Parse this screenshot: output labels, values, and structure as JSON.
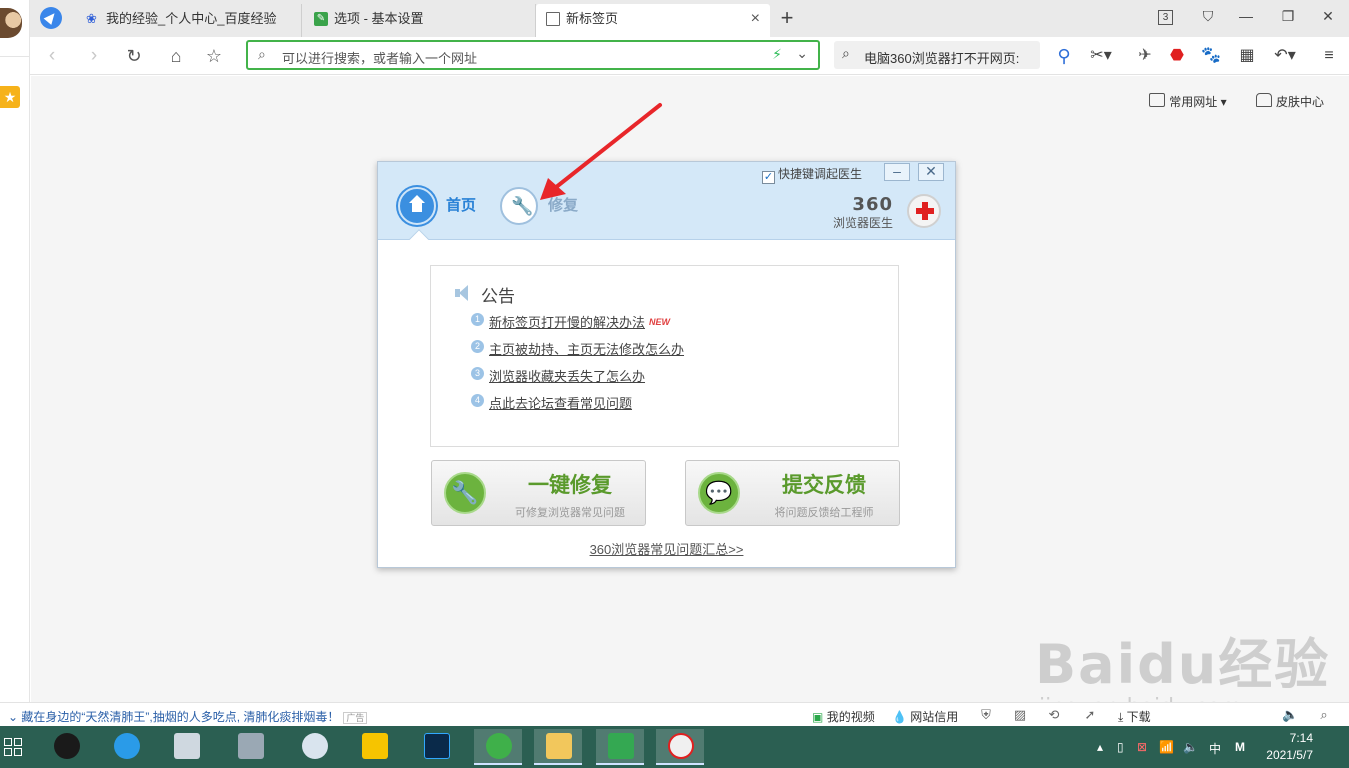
{
  "tabs": [
    {
      "title": "我的经验_个人中心_百度经验",
      "icon": "baidu-paw-icon"
    },
    {
      "title": "选项 - 基本设置",
      "icon": "settings-wrench-icon"
    },
    {
      "title": "新标签页",
      "icon": "new-tab-grid-icon"
    }
  ],
  "tab_count": "3",
  "address": {
    "placeholder": "可以进行搜索，或者输入一个网址"
  },
  "search_box": {
    "value": "电脑360浏览器打不开网页:"
  },
  "top_links": {
    "common_sites": "常用网址",
    "skin_center": "皮肤中心"
  },
  "doctor": {
    "quick_key_label": "快捷键调起医生",
    "nav_home": "首页",
    "nav_repair": "修复",
    "brand_number": "360",
    "brand_name": "浏览器医生",
    "notice_title": "公告",
    "notices": [
      {
        "num": "1",
        "text": "新标签页打开慢的解决办法",
        "tag": "NEW"
      },
      {
        "num": "2",
        "text": "主页被劫持、主页无法修改怎么办",
        "tag": ""
      },
      {
        "num": "3",
        "text": "浏览器收藏夹丢失了怎么办",
        "tag": ""
      },
      {
        "num": "4",
        "text": "点此去论坛查看常见问题",
        "tag": ""
      }
    ],
    "repair_button": {
      "title": "一键修复",
      "subtitle": "可修复浏览器常见问题"
    },
    "feedback_button": {
      "title": "提交反馈",
      "subtitle": "将问题反馈给工程师"
    },
    "faq_link": "360浏览器常见问题汇总>>"
  },
  "statusbar": {
    "ad_text": "藏在身边的“天然清肺王”,抽烟的人多吃点, 清肺化痰排烟毒！",
    "my_video": "我的视频",
    "site_credit": "网站信用",
    "download": "下载"
  },
  "watermark": {
    "main": "Baidu经验",
    "sub": "jingyan.baidu.com"
  },
  "taskbar": {
    "ime": "中",
    "ime_mode": "M",
    "time": "7:14",
    "date": "2021/5/7"
  },
  "colors": {
    "address_border": "#43b34a",
    "taskbar": "#2b5f52",
    "doctor_header": "#d4e8f8",
    "button_green": "#6cb33e"
  }
}
